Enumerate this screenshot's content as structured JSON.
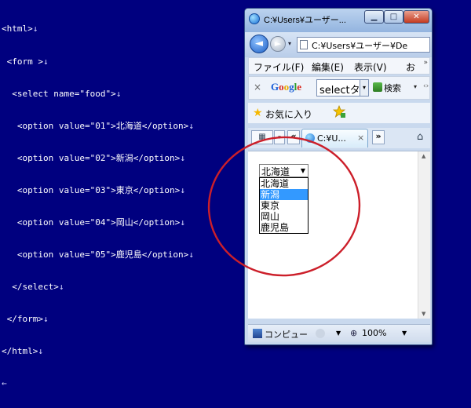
{
  "editor": {
    "lines": [
      "<html>",
      " <form >",
      "  <select name=\"food\">",
      "   <option value=\"01\">北海道</option>",
      "   <option value=\"02\">新潟</option>",
      "   <option value=\"03\">東京</option>",
      "   <option value=\"04\">岡山</option>",
      "   <option value=\"05\">鹿児島</option>",
      "  </select>",
      " </form>",
      "</html>"
    ],
    "line_end_mark": "↓",
    "eof_mark": "←"
  },
  "window": {
    "title": "C:¥Users¥ユーザー...",
    "min_glyph": "▁",
    "max_glyph": "□",
    "close_glyph": "✕"
  },
  "address": {
    "value": "C:¥Users¥ユーザー¥De",
    "back_glyph": "◄",
    "fwd_glyph": "►"
  },
  "menu": {
    "items": [
      "ファイル(F)",
      "編集(E)",
      "表示(V)",
      "お"
    ],
    "more": "»"
  },
  "google_toolbar": {
    "close": "×",
    "logo": "Google",
    "search_value": "selectタ",
    "search_label": "検索",
    "drop": "▾",
    "more": "‹›"
  },
  "favorites": {
    "label": "お気に入り"
  },
  "tabs": {
    "quick_tabs": "▦",
    "tab_list_drop": "▾",
    "scroll_left": "«",
    "scroll_right": "»",
    "active_tab_label": "C:¥U...",
    "close": "×"
  },
  "select": {
    "closed_value": "北海道",
    "options": [
      "北海道",
      "新潟",
      "東京",
      "岡山",
      "鹿児島"
    ],
    "selected_index": 1
  },
  "status": {
    "zone": "コンピュー",
    "zoom": "100%"
  },
  "colors": {
    "background": "#00007f",
    "annotation": "#cc1f2a",
    "selection": "#3399ff"
  }
}
